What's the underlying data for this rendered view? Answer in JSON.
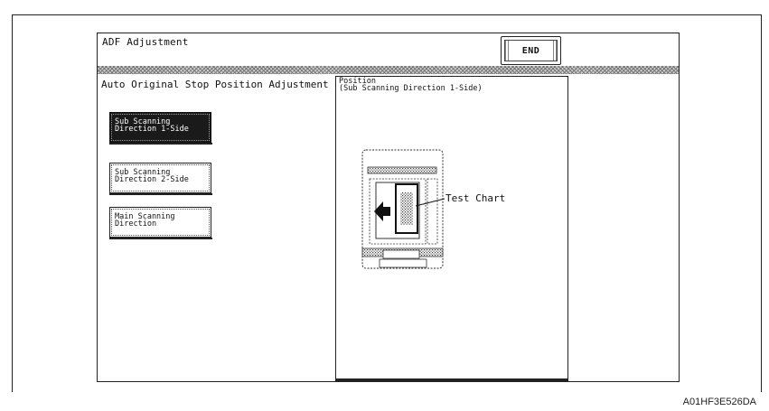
{
  "window": {
    "title": "ADF Adjustment"
  },
  "toolbar": {
    "end_label": "END"
  },
  "left_pane": {
    "heading": "Auto Original Stop Position Adjustment",
    "options": [
      {
        "line1": "Sub Scanning",
        "line2": "Direction 1-Side",
        "selected": true
      },
      {
        "line1": "Sub Scanning",
        "line2": "Direction 2-Side",
        "selected": false
      },
      {
        "line1": "Main Scanning",
        "line2": "Direction",
        "selected": false
      }
    ]
  },
  "position_panel": {
    "title_line1": "Position",
    "title_line2": "(Sub Scanning Direction 1-Side)",
    "diagram_label": "Test Chart"
  },
  "footer": {
    "doc_id": "A01HF3E526DA"
  }
}
